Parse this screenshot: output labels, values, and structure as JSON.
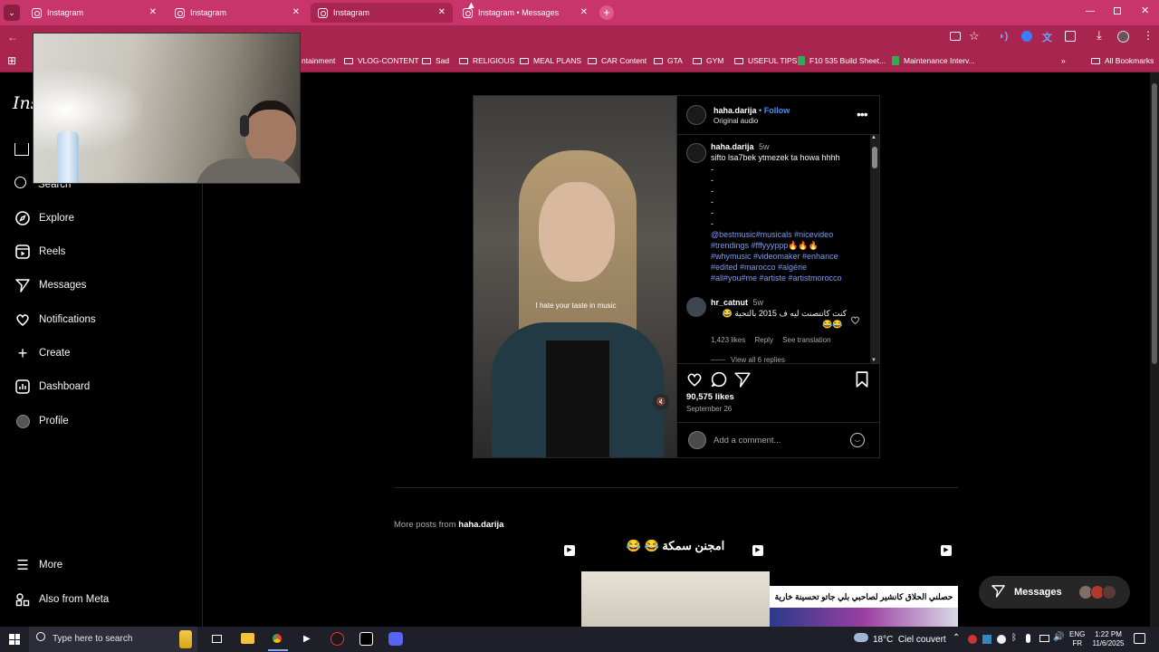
{
  "browser": {
    "tabs": [
      {
        "title": "Instagram",
        "active": false
      },
      {
        "title": "Instagram",
        "active": false
      },
      {
        "title": "Instagram",
        "active": true
      },
      {
        "title": "Instagram • Messages",
        "active": false
      }
    ],
    "bookmarks": [
      "ntainment",
      "VLOG-CONTENT",
      "Sad",
      "RELIGIOUS",
      "MEAL PLANS",
      "CAR Content",
      "GTA",
      "GYM",
      "USEFUL TIPS",
      "F10 535 Build Sheet...",
      "Maintenance Interv..."
    ],
    "all_bookmarks": "All Bookmarks",
    "theme_color": "#a8254f"
  },
  "sidebar": {
    "logo": "Ins",
    "search": "Search",
    "items": [
      {
        "label": "Explore",
        "icon": "compass-icon"
      },
      {
        "label": "Reels",
        "icon": "reels-icon"
      },
      {
        "label": "Messages",
        "icon": "messenger-icon"
      },
      {
        "label": "Notifications",
        "icon": "heart-icon"
      },
      {
        "label": "Create",
        "icon": "plus-icon"
      },
      {
        "label": "Dashboard",
        "icon": "dashboard-icon"
      },
      {
        "label": "Profile",
        "icon": "avatar-icon"
      }
    ],
    "more": "More",
    "also_from_meta": "Also from Meta"
  },
  "post": {
    "username": "haha.darija",
    "dot": "•",
    "follow": "Follow",
    "audio": "Original audio",
    "caption_user": "haha.darija",
    "caption_time": "5w",
    "caption_text": "sifto lsa7bek ytmezek ta howa hhhh",
    "dashes": [
      "-",
      "-",
      "-",
      "-",
      "-",
      "-"
    ],
    "hashtag_lines": [
      "@bestmusic#musicals #nicevideo",
      "#trendings #fffyyyppp🔥🔥🔥",
      "#whymusic #videomaker #enhance",
      "#edited #marocco #algérie",
      "#all#you#me #artiste #artistmorocco"
    ],
    "video_subtitle": "I hate your taste in music",
    "comment": {
      "user": "hr_catnut",
      "time": "5w",
      "text": "كنت كانتصنت ليه ف 2015 بالتحية 😂",
      "emoji_line": "😂😂",
      "likes": "1,423 likes",
      "reply": "Reply",
      "translation": "See translation",
      "view_replies": "View all 6 replies"
    },
    "likes": "90,575 likes",
    "date": "September 26",
    "add_comment": "Add a comment..."
  },
  "more_posts": {
    "label": "More posts from",
    "user": "haha.darija",
    "thumb2_title": "😂 😂 امجنن سمكة",
    "thumb3_caption": "حصلني الحلاق كانشير لصاحبي بلي جاتو تحسينة خارية"
  },
  "messages_pill": "Messages",
  "taskbar": {
    "search": "Type here to search",
    "weather": "18°C  Ciel couvert",
    "lang": "ENG",
    "region": "FR",
    "time": "1:22 PM",
    "date": "11/6/2025"
  }
}
